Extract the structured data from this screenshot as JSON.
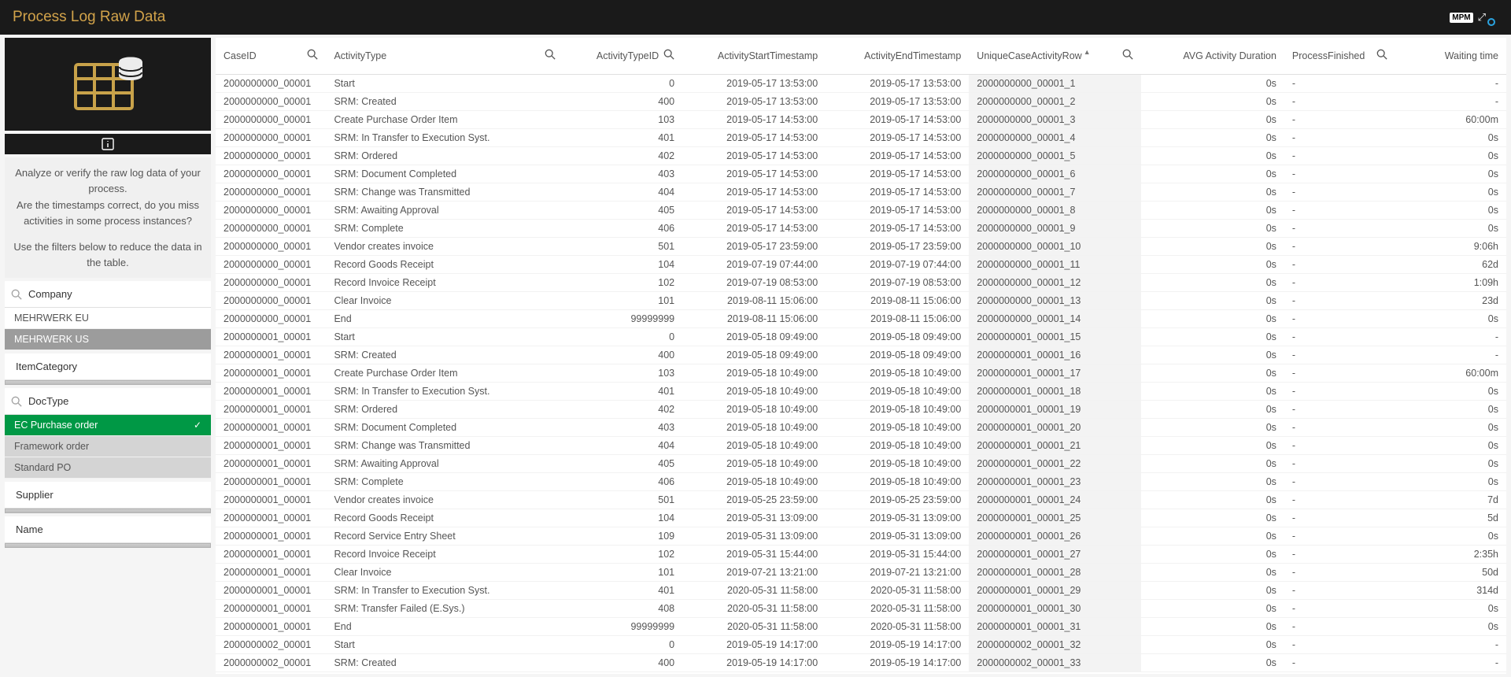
{
  "topbar": {
    "title": "Process Log Raw Data",
    "logo": "MPM"
  },
  "sidebar": {
    "hint_p1": "Analyze or verify the raw log data of your process.",
    "hint_p2": "Are the timestamps correct, do you miss activities in some process instances?",
    "hint_p3": "Use the filters below to reduce the data in the table.",
    "filters": {
      "company": {
        "label": "Company",
        "items": [
          "MEHRWERK EU",
          "MEHRWERK US"
        ],
        "selected_index": 1
      },
      "item_category": {
        "label": "ItemCategory"
      },
      "doc_type": {
        "label": "DocType",
        "items": [
          "EC Purchase order",
          "Framework order",
          "Standard PO"
        ],
        "selected_index": 0
      },
      "supplier": {
        "label": "Supplier"
      },
      "name": {
        "label": "Name"
      }
    }
  },
  "table": {
    "columns": [
      {
        "label": "CaseID",
        "searchable": true,
        "align": "left"
      },
      {
        "label": "ActivityType",
        "searchable": true,
        "align": "left"
      },
      {
        "label": "ActivityTypeID",
        "searchable": true,
        "align": "right"
      },
      {
        "label": "ActivityStartTimestamp",
        "searchable": false,
        "align": "right"
      },
      {
        "label": "ActivityEndTimestamp",
        "searchable": false,
        "align": "right"
      },
      {
        "label": "UniqueCaseActivityRow",
        "searchable": true,
        "align": "left",
        "sorted": true
      },
      {
        "label": "AVG Activity Duration",
        "searchable": false,
        "align": "right"
      },
      {
        "label": "ProcessFinished",
        "searchable": true,
        "align": "left"
      },
      {
        "label": "Waiting time",
        "searchable": false,
        "align": "right"
      }
    ],
    "rows": [
      [
        "2000000000_00001",
        "Start",
        "0",
        "2019-05-17 13:53:00",
        "2019-05-17 13:53:00",
        "2000000000_00001_1",
        "0s",
        "-",
        "-"
      ],
      [
        "2000000000_00001",
        "SRM: Created",
        "400",
        "2019-05-17 13:53:00",
        "2019-05-17 13:53:00",
        "2000000000_00001_2",
        "0s",
        "-",
        "-"
      ],
      [
        "2000000000_00001",
        "Create Purchase Order Item",
        "103",
        "2019-05-17 14:53:00",
        "2019-05-17 14:53:00",
        "2000000000_00001_3",
        "0s",
        "-",
        "60:00m"
      ],
      [
        "2000000000_00001",
        "SRM: In Transfer to Execution Syst.",
        "401",
        "2019-05-17 14:53:00",
        "2019-05-17 14:53:00",
        "2000000000_00001_4",
        "0s",
        "-",
        "0s"
      ],
      [
        "2000000000_00001",
        "SRM: Ordered",
        "402",
        "2019-05-17 14:53:00",
        "2019-05-17 14:53:00",
        "2000000000_00001_5",
        "0s",
        "-",
        "0s"
      ],
      [
        "2000000000_00001",
        "SRM: Document Completed",
        "403",
        "2019-05-17 14:53:00",
        "2019-05-17 14:53:00",
        "2000000000_00001_6",
        "0s",
        "-",
        "0s"
      ],
      [
        "2000000000_00001",
        "SRM: Change was Transmitted",
        "404",
        "2019-05-17 14:53:00",
        "2019-05-17 14:53:00",
        "2000000000_00001_7",
        "0s",
        "-",
        "0s"
      ],
      [
        "2000000000_00001",
        "SRM: Awaiting Approval",
        "405",
        "2019-05-17 14:53:00",
        "2019-05-17 14:53:00",
        "2000000000_00001_8",
        "0s",
        "-",
        "0s"
      ],
      [
        "2000000000_00001",
        "SRM: Complete",
        "406",
        "2019-05-17 14:53:00",
        "2019-05-17 14:53:00",
        "2000000000_00001_9",
        "0s",
        "-",
        "0s"
      ],
      [
        "2000000000_00001",
        "Vendor creates invoice",
        "501",
        "2019-05-17 23:59:00",
        "2019-05-17 23:59:00",
        "2000000000_00001_10",
        "0s",
        "-",
        "9:06h"
      ],
      [
        "2000000000_00001",
        "Record Goods Receipt",
        "104",
        "2019-07-19 07:44:00",
        "2019-07-19 07:44:00",
        "2000000000_00001_11",
        "0s",
        "-",
        "62d"
      ],
      [
        "2000000000_00001",
        "Record Invoice Receipt",
        "102",
        "2019-07-19 08:53:00",
        "2019-07-19 08:53:00",
        "2000000000_00001_12",
        "0s",
        "-",
        "1:09h"
      ],
      [
        "2000000000_00001",
        "Clear Invoice",
        "101",
        "2019-08-11 15:06:00",
        "2019-08-11 15:06:00",
        "2000000000_00001_13",
        "0s",
        "-",
        "23d"
      ],
      [
        "2000000000_00001",
        "End",
        "99999999",
        "2019-08-11 15:06:00",
        "2019-08-11 15:06:00",
        "2000000000_00001_14",
        "0s",
        "-",
        "0s"
      ],
      [
        "2000000001_00001",
        "Start",
        "0",
        "2019-05-18 09:49:00",
        "2019-05-18 09:49:00",
        "2000000001_00001_15",
        "0s",
        "-",
        "-"
      ],
      [
        "2000000001_00001",
        "SRM: Created",
        "400",
        "2019-05-18 09:49:00",
        "2019-05-18 09:49:00",
        "2000000001_00001_16",
        "0s",
        "-",
        "-"
      ],
      [
        "2000000001_00001",
        "Create Purchase Order Item",
        "103",
        "2019-05-18 10:49:00",
        "2019-05-18 10:49:00",
        "2000000001_00001_17",
        "0s",
        "-",
        "60:00m"
      ],
      [
        "2000000001_00001",
        "SRM: In Transfer to Execution Syst.",
        "401",
        "2019-05-18 10:49:00",
        "2019-05-18 10:49:00",
        "2000000001_00001_18",
        "0s",
        "-",
        "0s"
      ],
      [
        "2000000001_00001",
        "SRM: Ordered",
        "402",
        "2019-05-18 10:49:00",
        "2019-05-18 10:49:00",
        "2000000001_00001_19",
        "0s",
        "-",
        "0s"
      ],
      [
        "2000000001_00001",
        "SRM: Document Completed",
        "403",
        "2019-05-18 10:49:00",
        "2019-05-18 10:49:00",
        "2000000001_00001_20",
        "0s",
        "-",
        "0s"
      ],
      [
        "2000000001_00001",
        "SRM: Change was Transmitted",
        "404",
        "2019-05-18 10:49:00",
        "2019-05-18 10:49:00",
        "2000000001_00001_21",
        "0s",
        "-",
        "0s"
      ],
      [
        "2000000001_00001",
        "SRM: Awaiting Approval",
        "405",
        "2019-05-18 10:49:00",
        "2019-05-18 10:49:00",
        "2000000001_00001_22",
        "0s",
        "-",
        "0s"
      ],
      [
        "2000000001_00001",
        "SRM: Complete",
        "406",
        "2019-05-18 10:49:00",
        "2019-05-18 10:49:00",
        "2000000001_00001_23",
        "0s",
        "-",
        "0s"
      ],
      [
        "2000000001_00001",
        "Vendor creates invoice",
        "501",
        "2019-05-25 23:59:00",
        "2019-05-25 23:59:00",
        "2000000001_00001_24",
        "0s",
        "-",
        "7d"
      ],
      [
        "2000000001_00001",
        "Record Goods Receipt",
        "104",
        "2019-05-31 13:09:00",
        "2019-05-31 13:09:00",
        "2000000001_00001_25",
        "0s",
        "-",
        "5d"
      ],
      [
        "2000000001_00001",
        "Record Service Entry Sheet",
        "109",
        "2019-05-31 13:09:00",
        "2019-05-31 13:09:00",
        "2000000001_00001_26",
        "0s",
        "-",
        "0s"
      ],
      [
        "2000000001_00001",
        "Record Invoice Receipt",
        "102",
        "2019-05-31 15:44:00",
        "2019-05-31 15:44:00",
        "2000000001_00001_27",
        "0s",
        "-",
        "2:35h"
      ],
      [
        "2000000001_00001",
        "Clear Invoice",
        "101",
        "2019-07-21 13:21:00",
        "2019-07-21 13:21:00",
        "2000000001_00001_28",
        "0s",
        "-",
        "50d"
      ],
      [
        "2000000001_00001",
        "SRM: In Transfer to Execution Syst.",
        "401",
        "2020-05-31 11:58:00",
        "2020-05-31 11:58:00",
        "2000000001_00001_29",
        "0s",
        "-",
        "314d"
      ],
      [
        "2000000001_00001",
        "SRM: Transfer Failed (E.Sys.)",
        "408",
        "2020-05-31 11:58:00",
        "2020-05-31 11:58:00",
        "2000000001_00001_30",
        "0s",
        "-",
        "0s"
      ],
      [
        "2000000001_00001",
        "End",
        "99999999",
        "2020-05-31 11:58:00",
        "2020-05-31 11:58:00",
        "2000000001_00001_31",
        "0s",
        "-",
        "0s"
      ],
      [
        "2000000002_00001",
        "Start",
        "0",
        "2019-05-19 14:17:00",
        "2019-05-19 14:17:00",
        "2000000002_00001_32",
        "0s",
        "-",
        "-"
      ],
      [
        "2000000002_00001",
        "SRM: Created",
        "400",
        "2019-05-19 14:17:00",
        "2019-05-19 14:17:00",
        "2000000002_00001_33",
        "0s",
        "-",
        "-"
      ]
    ]
  }
}
